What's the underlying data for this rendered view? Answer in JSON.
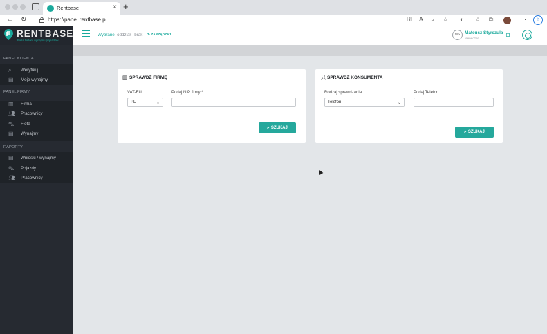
{
  "browser": {
    "tab_title": "Rentbase",
    "tab_close": "×",
    "new_tab": "+",
    "url": "https://panel.rentbase.pl",
    "back": "←",
    "refresh": "↻"
  },
  "header": {
    "logo_name": "RENTBASE",
    "logo_tagline": "Baza historii wynajmu pojazdów",
    "selected_prefix": "Wybrane:",
    "selected_value": "oddział: -brak-",
    "manage_label": "ZARZĄDZAJ",
    "user_initials": "MS",
    "user_name": "Mateusz Styrczula",
    "user_role": "Menedżer"
  },
  "sidebar": {
    "sections": [
      {
        "title": "PANEL KLIENTA",
        "items": [
          {
            "label": "Weryfikuj",
            "icon": "search-icon"
          },
          {
            "label": "Moje wynajmy",
            "icon": "document-icon"
          }
        ]
      },
      {
        "title": "PANEL FIRMY",
        "items": [
          {
            "label": "Firma",
            "icon": "building-icon"
          },
          {
            "label": "Pracownicy",
            "icon": "users-icon"
          },
          {
            "label": "Flota",
            "icon": "car-icon"
          },
          {
            "label": "Wynajmy",
            "icon": "document-icon"
          }
        ]
      },
      {
        "title": "RAPORTY",
        "items": [
          {
            "label": "Wnioski / wynajmy",
            "icon": "document-icon"
          },
          {
            "label": "Pojazdy",
            "icon": "car-icon"
          },
          {
            "label": "Pracownicy",
            "icon": "users-icon"
          }
        ]
      }
    ]
  },
  "company_card": {
    "title": "SPRAWDŹ FIRMĘ",
    "country_label": "VAT-EU",
    "country_value": "PL",
    "nip_label": "Podaj NIP firmy *",
    "nip_value": "",
    "search_label": "SZUKAJ"
  },
  "consumer_card": {
    "title": "SPRAWDŹ KONSUMENTA",
    "type_label": "Rodzaj sprawdzania",
    "type_value": "Telefon",
    "phone_label": "Podaj Telefon",
    "phone_value": "",
    "search_label": "SZUKAJ"
  },
  "colors": {
    "accent": "#1aa99c",
    "sidebar_bg": "#262a31",
    "content_bg": "#e3e6e9"
  }
}
